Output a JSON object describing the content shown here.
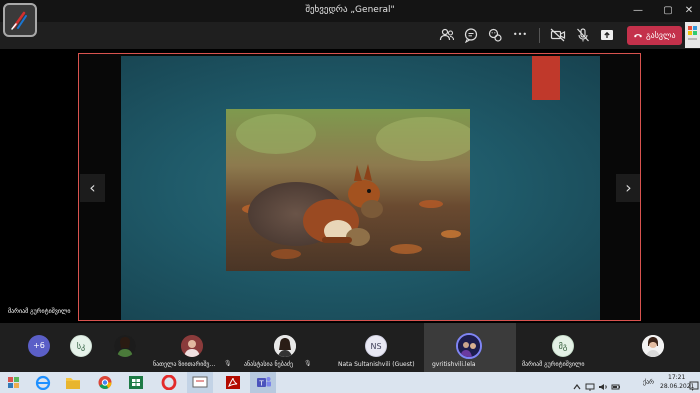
{
  "window": {
    "title": "შეხვედრა „General\"",
    "minimize_glyph": "—",
    "maximize_glyph": "▢",
    "close_glyph": "✕"
  },
  "toolbar": {
    "icons": [
      "participants-icon",
      "chat-icon",
      "reactions-icon",
      "more-options-icon",
      "camera-off-icon",
      "mic-off-icon",
      "share-tray-icon"
    ],
    "more_glyph": "•••",
    "leave_label": "გასვლა",
    "accent_color": "#c4314b"
  },
  "stage": {
    "presenter_name": "მარიამ გურიტიშვილი",
    "prev_glyph": "‹",
    "next_glyph": "›",
    "frame_color": "#d9534f",
    "slide_color": "#1f5a69",
    "accent_color": "#c0392b"
  },
  "participants": {
    "overflow": "+6",
    "items": [
      {
        "initials": "სკ",
        "name": ""
      },
      {
        "initials": "",
        "name": ""
      },
      {
        "initials": "",
        "name": "ნათელა ზიითარიშვ..."
      },
      {
        "initials": "",
        "name": "ანასტასია ნებაძე"
      },
      {
        "initials": "NS",
        "name": "Nata Sultanishvili (Guest)"
      },
      {
        "initials": "",
        "name": "gvritishvili.lela"
      },
      {
        "initials": "მგ",
        "name": "მარიამ გურიტიშვილი"
      },
      {
        "initials": "",
        "name": ""
      }
    ]
  },
  "taskbar": {
    "keyboard_lang": "ქარ",
    "time": "17:21",
    "date": "28.06.2021"
  }
}
